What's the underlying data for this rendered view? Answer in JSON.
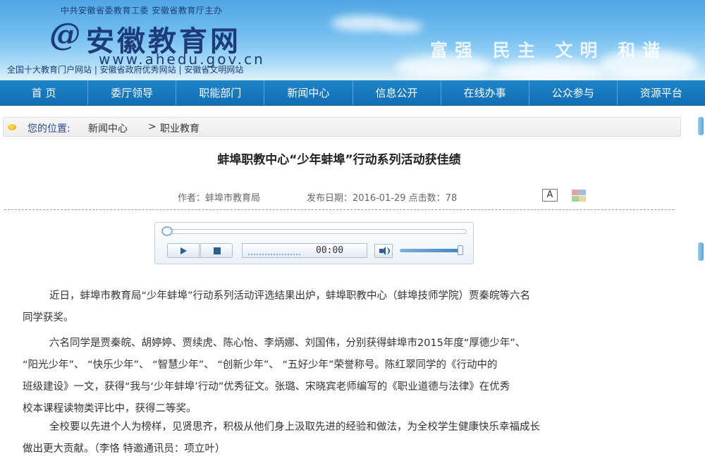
{
  "header": {
    "sponsor": "中共安徽省委教育工委  安徽省教育厅主办",
    "logo_mark": "@",
    "logo_name": "安徽教育网",
    "logo_url": "www.ahedu.gov.cn",
    "tagline": "全国十大教育门户网站  |  安徽省政府优秀网站  |  安徽省文明网站",
    "slogan": "富强 民主 文明 和谐"
  },
  "nav": {
    "items": [
      "首 页",
      "委厅领导",
      "职能部门",
      "新闻中心",
      "信息公开",
      "在线办事",
      "公众参与",
      "资源平台"
    ]
  },
  "breadcrumb": {
    "label": "您的位置:",
    "path1": "新闻中心",
    "separator": ">",
    "path2": "职业教育"
  },
  "article": {
    "title": "蚌埠职教中心“少年蚌埠”行动系列活动获佳绩",
    "author": "作者：蚌埠市教育局",
    "date_views": "发布日期：2016-01-29 点击数：78",
    "font_size_label": "A",
    "paragraphs": [
      [
        "近日，蚌埠市教育局“少年蚌埠”行动系列活动评选结果出炉，蚌埠职教中心（蚌埠技师学院）贾秦皖等六名",
        "同学获奖。"
      ],
      [
        "六名同学是贾秦皖、胡婷婷、贾续虎、陈心怡、李炳娜、刘国伟，分别获得蚌埠市2015年度“厚德少年”、",
        "“阳光少年”、 “快乐少年”、 “智慧少年”、 “创新少年”、 “五好少年”荣誉称号。陈红翠同学的《行动中的",
        "班级建设》一文，获得“我与‘少年蚌埠’行动”优秀征文。张璐、宋晓宾老师编写的《职业道德与法律》在优秀",
        "校本课程读物类评比中，获得二等奖。"
      ],
      [
        "全校要以先进个人为榜样，见贤思齐，积极从他们身上汲取先进的经验和做法，为全校学生健康快乐幸福成长",
        "做出更大贡献。（李恪 特邀通讯员：项立叶）"
      ]
    ]
  },
  "player": {
    "time": "00:00",
    "progress": 0,
    "volume": 1.0
  },
  "colors": {
    "nav_bg": "#1677bd",
    "banner_sky": "#4fa6e3",
    "logo_blue": "#1c3b78",
    "crumb_label": "#2a4b8d"
  }
}
